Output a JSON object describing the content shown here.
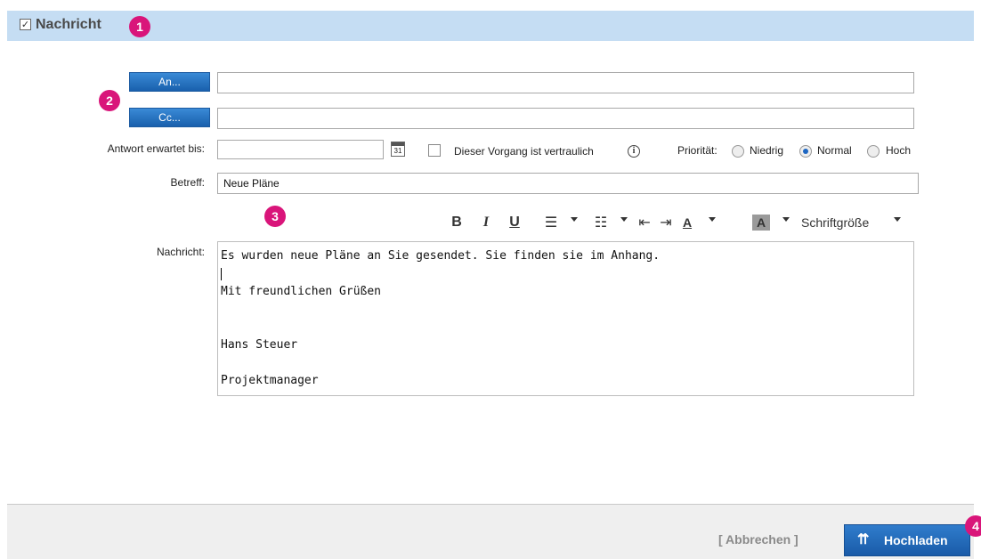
{
  "header": {
    "title": "Nachricht",
    "check_mark": "✓"
  },
  "badges": [
    "1",
    "2",
    "3",
    "4"
  ],
  "recipients": {
    "to_button": "An...",
    "to_value": "",
    "cc_button": "Cc...",
    "cc_value": ""
  },
  "reply": {
    "label": "Antwort erwartet bis:",
    "value": "",
    "calendar_day": "31"
  },
  "confidential": {
    "label": "Dieser Vorgang ist vertraulich",
    "checked": false,
    "info_glyph": "i"
  },
  "priority": {
    "label": "Priorität:",
    "options": [
      "Niedrig",
      "Normal",
      "Hoch"
    ],
    "selected": "Normal"
  },
  "subject": {
    "label": "Betreff:",
    "value": "Neue Pläne"
  },
  "toolbar": {
    "bold": "B",
    "italic": "I",
    "underline": "U",
    "bullet_list": "☰",
    "numbered_list": "☷",
    "outdent": "⇤",
    "indent": "⇥",
    "font_color": "A",
    "highlight": "A",
    "font_size": "Schriftgröße"
  },
  "message": {
    "label": "Nachricht:",
    "lines": [
      "Es wurden neue Pläne an Sie gesendet. Sie finden sie im Anhang.",
      "",
      "Mit freundlichen Grüßen",
      "",
      "",
      "Hans Steuer",
      "",
      "Projektmanager"
    ]
  },
  "footer": {
    "cancel": "[ Abbrechen ]",
    "upload": "Hochladen",
    "upload_icon": "upload-icon"
  },
  "colors": {
    "header_bg": "#c5ddf3",
    "button_blue": "#1960ad",
    "badge": "#d9157a",
    "footer_bg": "#efefef"
  }
}
